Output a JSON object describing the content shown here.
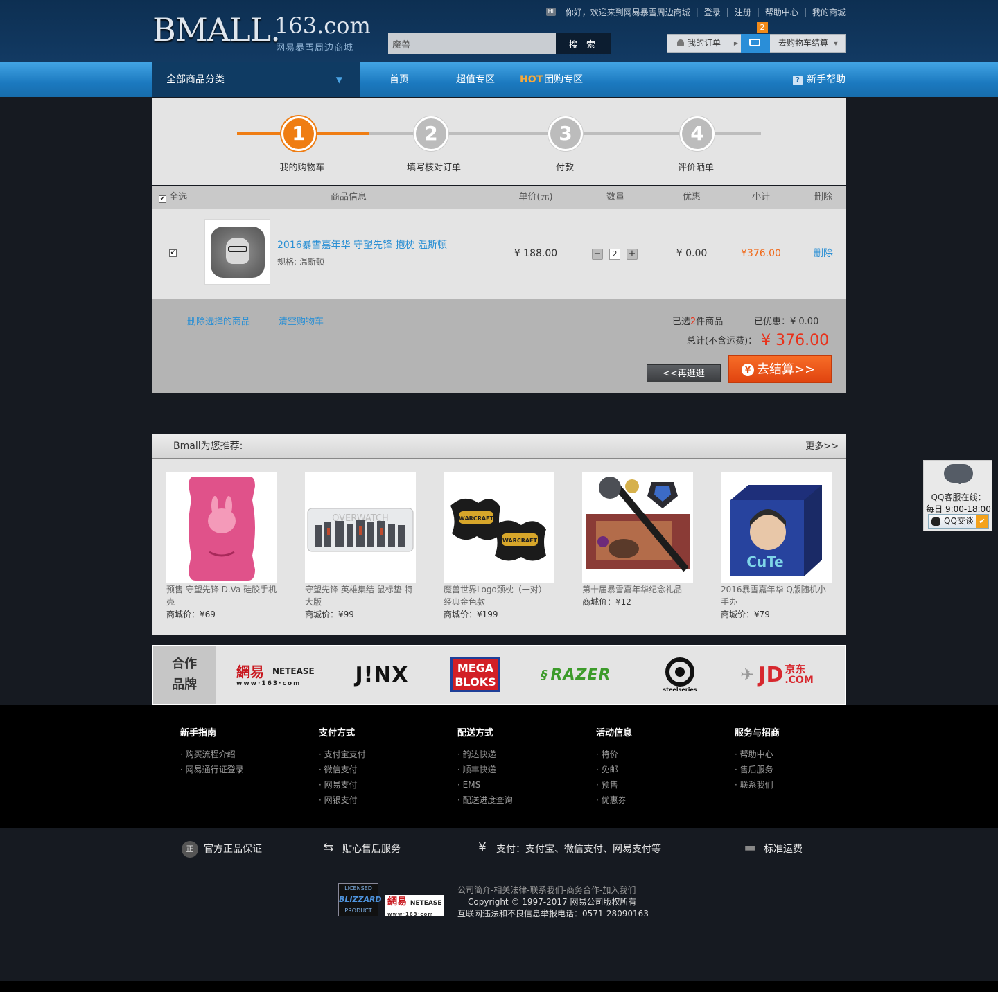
{
  "header": {
    "logo_main": "BMALL.",
    "logo_domain": "163.com",
    "logo_sub": "网易暴雪周边商城",
    "hi_badge": "Hi",
    "welcome": "你好，欢迎来到网易暴雪周边商城",
    "links": [
      "登录",
      "注册",
      "帮助中心",
      "我的商城"
    ],
    "search_value": "魔兽",
    "search_button": "搜 索",
    "my_orders": "我的订单",
    "cart_count": "2",
    "checkout": "去购物车结算"
  },
  "nav": {
    "all_categories": "全部商品分类",
    "items": [
      "首页",
      "超值专区",
      "团购专区"
    ],
    "hot_tag": "HOT",
    "help": "新手帮助"
  },
  "steps": [
    {
      "num": "1",
      "label": "我的购物车"
    },
    {
      "num": "2",
      "label": "填写核对订单"
    },
    {
      "num": "3",
      "label": "付款"
    },
    {
      "num": "4",
      "label": "评价晒单"
    }
  ],
  "cart": {
    "headers": {
      "select_all": "全选",
      "info": "商品信息",
      "price": "单价(元)",
      "qty": "数量",
      "discount": "优惠",
      "subtotal": "小计",
      "delete": "删除"
    },
    "item": {
      "title": "2016暴雪嘉年华 守望先锋 抱枕 温斯顿",
      "spec": "规格: 温斯顿",
      "price": "¥ 188.00",
      "qty": "2",
      "discount": "¥ 0.00",
      "subtotal": "¥376.00",
      "delete": "删除"
    },
    "footer": {
      "delete_selected": "删除选择的商品",
      "clear_cart": "清空购物车",
      "selected_prefix": "已选",
      "selected_count": "2",
      "selected_suffix": "件商品",
      "discount": "已优惠：¥ 0.00",
      "total_label": "总计(不含运费)：",
      "total_amount": "¥ 376.00",
      "continue": "<<再逛逛",
      "pay_icon": "¥",
      "pay": "去结算>>"
    }
  },
  "recommend": {
    "title": "Bmall为您推荐:",
    "more": "更多>>",
    "price_prefix": "商城价：",
    "items": [
      {
        "name": "预售 守望先锋 D.Va 硅胶手机壳",
        "price": "¥69"
      },
      {
        "name": "守望先锋 英雄集结 鼠标垫 特大版",
        "price": "¥99"
      },
      {
        "name": "魔兽世界Logo颈枕（一对） 经典金色款",
        "price": "¥199"
      },
      {
        "name": "第十届暴雪嘉年华纪念礼品",
        "price": "¥12"
      },
      {
        "name": "2016暴雪嘉年华 Q版随机小手办",
        "price": "¥79"
      }
    ],
    "overwatch_text": "OVERWATCH",
    "warcraft_text": "WARCRAFT",
    "cute_text": "CuTe"
  },
  "brands": {
    "title_line1": "合作",
    "title_line2": "品牌",
    "netease_cn": "網易",
    "netease_en": "NETEASE",
    "netease_web": "www·163·com",
    "jinx": "J!NX",
    "mega1": "MEGA",
    "mega2": "BLOKS",
    "razer": "RAZER",
    "steelseries": "steelseries",
    "jd": "JD",
    "jd_cn": "京东",
    "jd_com": ".COM"
  },
  "footer": {
    "columns": [
      {
        "title": "新手指南",
        "items": [
          "· 购买流程介绍",
          "· 网易通行证登录"
        ]
      },
      {
        "title": "支付方式",
        "items": [
          "· 支付宝支付",
          "· 微信支付",
          "· 网易支付",
          "· 网银支付"
        ]
      },
      {
        "title": "配送方式",
        "items": [
          "· 韵达快递",
          "· 顺丰快递",
          "· EMS",
          "· 配送进度查询"
        ]
      },
      {
        "title": "活动信息",
        "items": [
          "· 特价",
          "· 免邮",
          "· 预售",
          "· 优惠券"
        ]
      },
      {
        "title": "服务与招商",
        "items": [
          "· 帮助中心",
          "· 售后服务",
          "· 联系我们"
        ]
      }
    ],
    "guarantees": [
      {
        "icon": "正",
        "text": "官方正品保证"
      },
      {
        "icon": "⇆",
        "text": "贴心售后服务"
      },
      {
        "icon": "¥",
        "text": "支付：支付宝、微信支付、网易支付等"
      },
      {
        "icon": "▬",
        "text": "标准运费"
      }
    ],
    "links": "公司简介-相关法律-联系我们-商务合作-加入我们",
    "copyright": "Copyright © 1997-2017 网易公司版权所有",
    "report": "互联网违法和不良信息举报电话：0571-28090163",
    "blizzard_top": "LICENSED",
    "blizzard_main": "BLIZZARD",
    "blizzard_bottom": "PRODUCT"
  },
  "qq": {
    "line1": "QQ客服在线：",
    "line2": "每日 9:00-18:00",
    "button": "QQ交谈"
  }
}
